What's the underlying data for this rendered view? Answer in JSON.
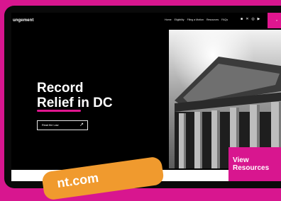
{
  "brand": "ungement",
  "nav": {
    "links": [
      "Home",
      "Eligibility",
      "Filing a Motion",
      "Resources",
      "FAQs"
    ],
    "social_icons": [
      "facebook-icon",
      "x-icon",
      "instagram-icon",
      "youtube-icon"
    ]
  },
  "hero": {
    "title_line1": "Record",
    "title_line2": "Relief in DC",
    "button_label": "Read the Law",
    "button_icon": "external-arrow-icon"
  },
  "resources_box": {
    "line1": "View",
    "line2": "Resources"
  },
  "sticker_text": "nt.com",
  "colors": {
    "accent": "#d8168f",
    "background": "#000000",
    "sticker": "#f09a2e"
  }
}
